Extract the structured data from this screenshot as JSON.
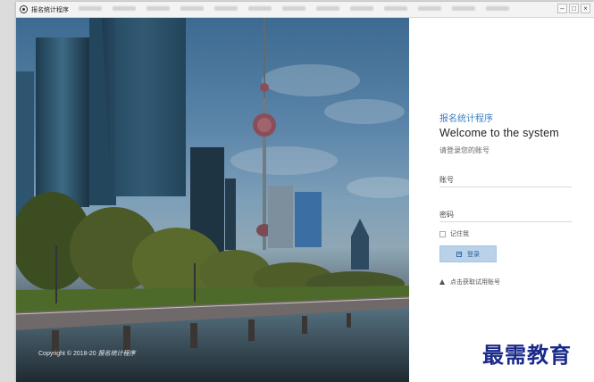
{
  "window": {
    "title": "报名统计程序",
    "controls": {
      "minimize": "–",
      "maximize": "□",
      "close": "×"
    }
  },
  "hero": {
    "copyright_prefix": "Copyright © 2018-20",
    "copyright_app": "报名统计程序"
  },
  "login": {
    "brand": "报名统计程序",
    "welcome": "Welcome to the system",
    "subtitle": "请登录您的账号",
    "account_label": "账号",
    "account_value": "",
    "password_label": "密码",
    "password_value": "",
    "remember_label": "记住我",
    "remember_checked": false,
    "login_button": "登录",
    "trial_link": "点击获取试用账号"
  },
  "watermark": {
    "text": "最需教育"
  },
  "colors": {
    "accent": "#3a7fc1",
    "button_bg": "#b9d2ea",
    "watermark": "#1a2a8a"
  },
  "icons": {
    "app": "app-logo-icon",
    "login": "login-icon",
    "trial": "warning-icon"
  }
}
